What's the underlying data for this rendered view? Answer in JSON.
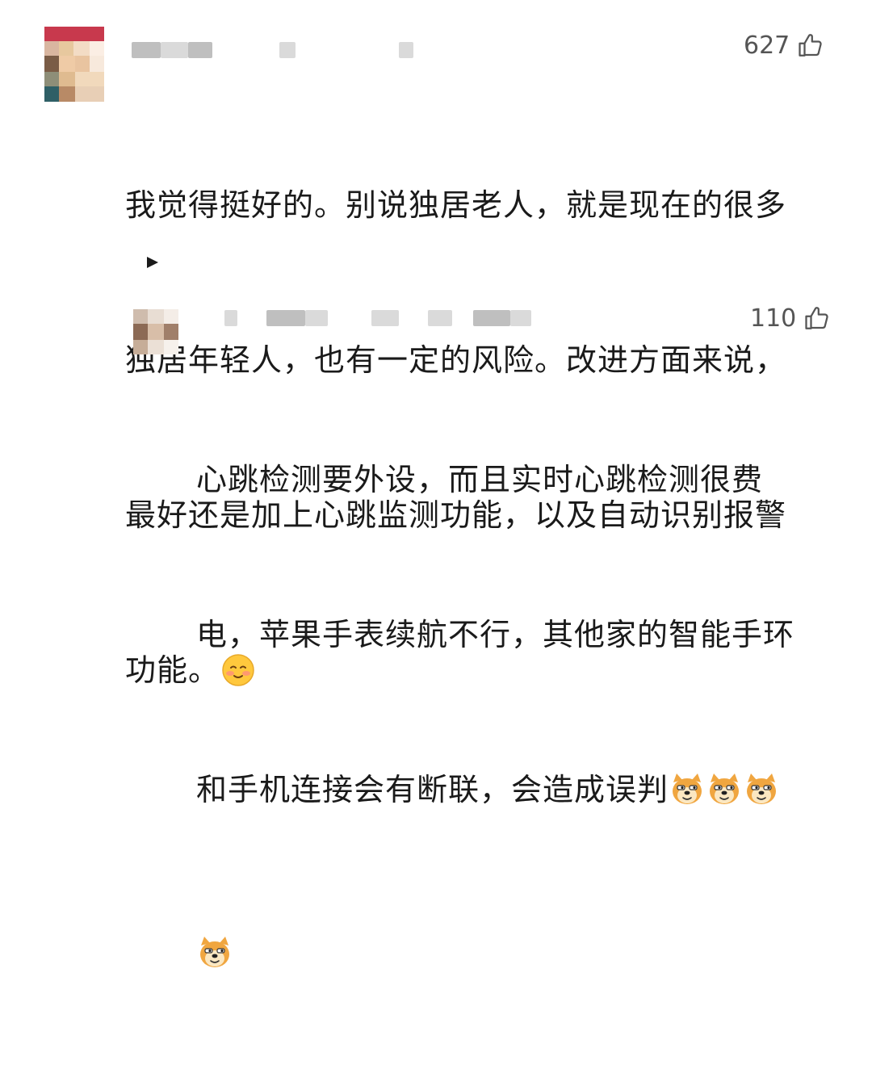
{
  "colors": {
    "text": "#1a1a1a",
    "meta": "#555555",
    "placeholder_blur": "#dadada",
    "emoji_yellow": "#ffc83d",
    "emoji_blush": "#ff8a80",
    "doge_orange": "#f0a640"
  },
  "comments": [
    {
      "likes": "627",
      "like_icon": "thumbs-up-outline-icon",
      "text_lines": [
        "我觉得挺好的。别说独居老人，就是现在的很多",
        "独居年轻人，也有一定的风险。改进方面来说，",
        "最好还是加上心跳监测功能，以及自动识别报警",
        "功能。"
      ],
      "emoji": "blushing-smile-emoji"
    },
    {
      "likes": "110",
      "like_icon": "thumbs-up-outline-icon",
      "text_lines": [
        "心跳检测要外设，而且实时心跳检测很费",
        "电，苹果手表续航不行，其他家的智能手环",
        "和手机连接会有断联，会造成误判"
      ],
      "emoji": "doge-emoji"
    }
  ]
}
